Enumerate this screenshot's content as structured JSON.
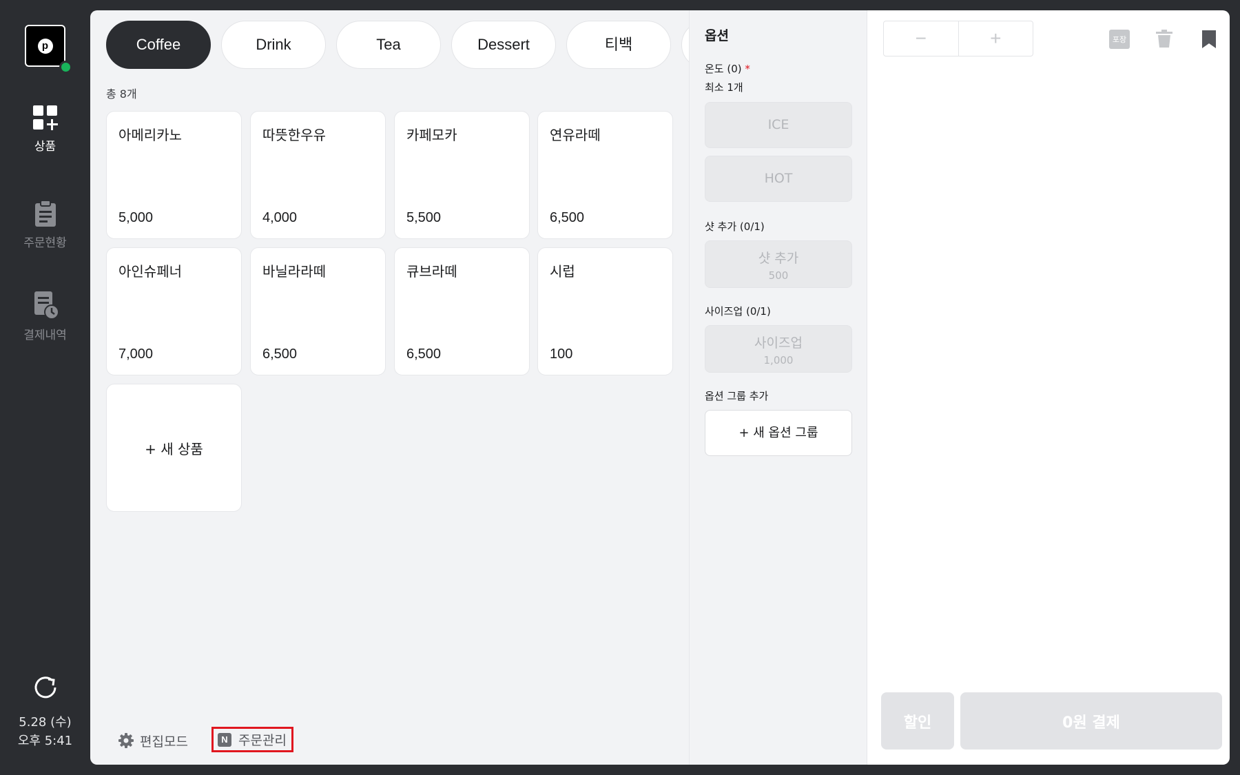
{
  "sidebar": {
    "logo_letter": "p",
    "nav": [
      {
        "label": "상품",
        "icon": "product-grid-add-icon",
        "active": true
      },
      {
        "label": "주문현황",
        "icon": "clipboard-icon",
        "active": false
      },
      {
        "label": "결제내역",
        "icon": "receipt-clock-icon",
        "active": false
      }
    ],
    "date": "5.28 (수)",
    "time": "오후 5:41"
  },
  "categories": [
    "Coffee",
    "Drink",
    "Tea",
    "Dessert",
    "티백"
  ],
  "active_category": "Coffee",
  "product_count": "총 8개",
  "products": [
    {
      "name": "아메리카노",
      "price": "5,000"
    },
    {
      "name": "따뜻한우유",
      "price": "4,000"
    },
    {
      "name": "카페모카",
      "price": "5,500"
    },
    {
      "name": "연유라떼",
      "price": "6,500"
    },
    {
      "name": "아인슈페너",
      "price": "7,000"
    },
    {
      "name": "바닐라라떼",
      "price": "6,500"
    },
    {
      "name": "큐브라떼",
      "price": "6,500"
    },
    {
      "name": "시럽",
      "price": "100"
    }
  ],
  "new_product_label": "+ 새 상품",
  "bottom": {
    "edit_mode": "편집모드",
    "order_mgmt_badge": "N",
    "order_mgmt": "주문관리"
  },
  "options": {
    "title": "옵션",
    "temperature_label": "온도 (0)",
    "required_mark": "*",
    "temperature_min": "최소 1개",
    "temperature_choices": [
      "ICE",
      "HOT"
    ],
    "shot_label": "샷 추가 (0/1)",
    "shot_name": "샷 추가",
    "shot_price": "500",
    "size_label": "사이즈업 (0/1)",
    "size_name": "사이즈업",
    "size_price": "1,000",
    "add_group_label": "옵션 그룹 추가",
    "new_group_button": "+ 새 옵션 그룹"
  },
  "cart": {
    "minus": "−",
    "plus": "+",
    "pack_badge": "포장",
    "discount_button": "할인",
    "pay_button": "0원 결제"
  }
}
